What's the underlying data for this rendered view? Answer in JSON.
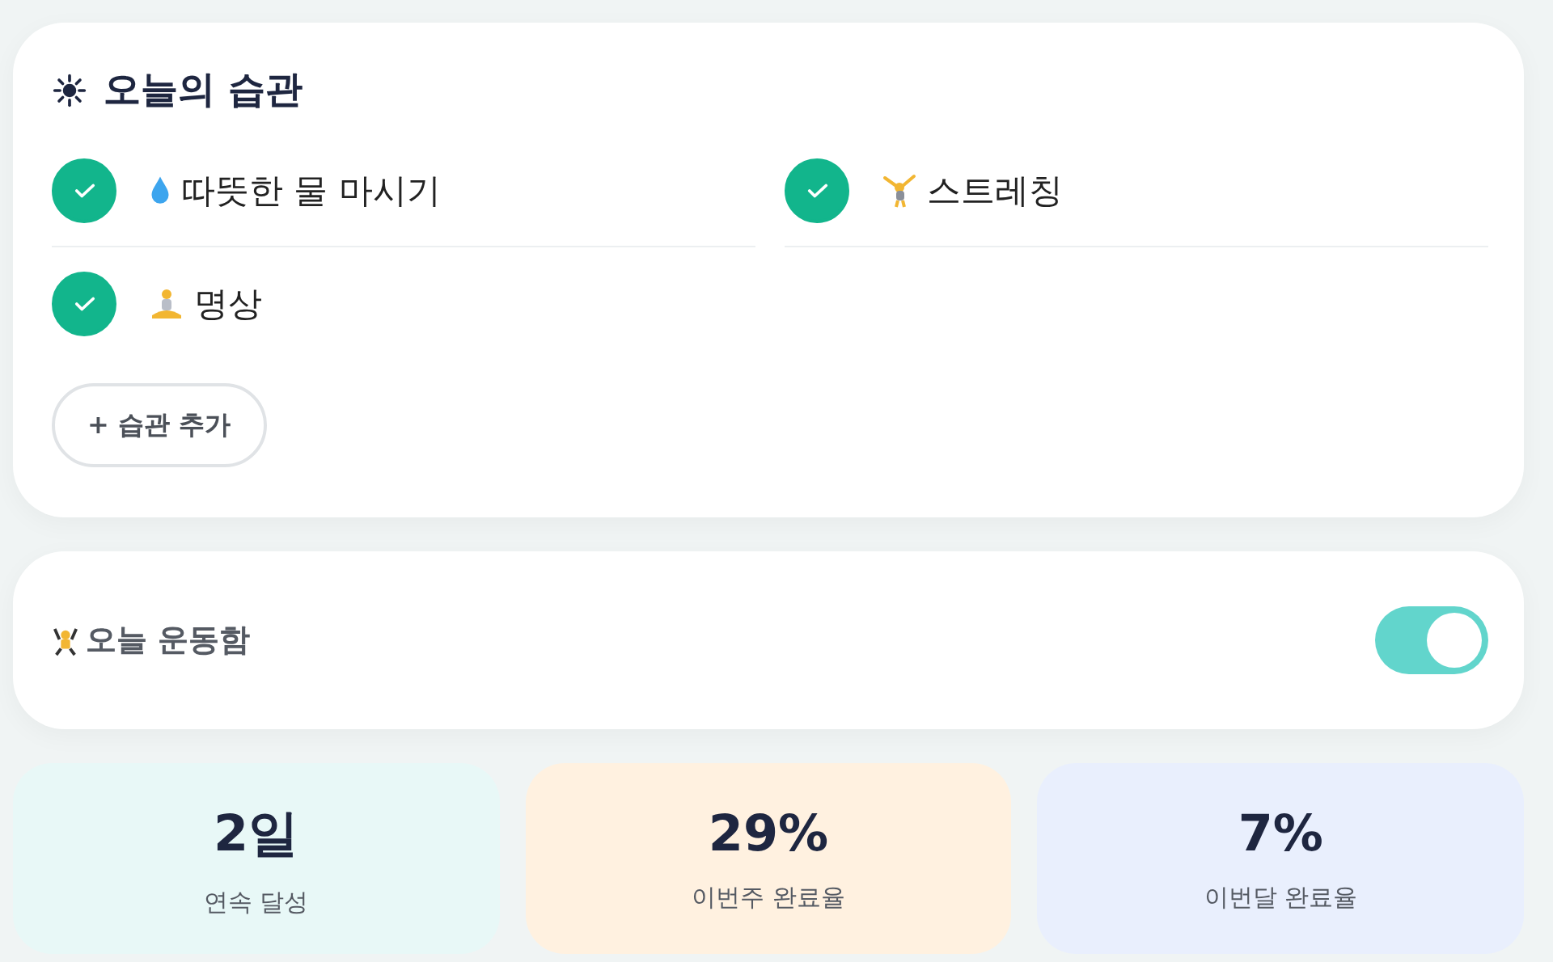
{
  "habits_card": {
    "title": "오늘의 습관",
    "habits": [
      {
        "label": "따뜻한 물 마시기",
        "kind": "drop",
        "checked": true
      },
      {
        "label": "스트레칭",
        "kind": "stretch",
        "checked": true
      },
      {
        "label": "명상",
        "kind": "meditate",
        "checked": true
      }
    ],
    "add_button": "+ 습관 추가"
  },
  "exercise_card": {
    "label": "오늘 운동함",
    "on": true
  },
  "stats": [
    {
      "value": "2일",
      "label": "연속 달성",
      "color": "#e8f8f7"
    },
    {
      "value": "29%",
      "label": "이번주 완료율",
      "color": "#fff1e0"
    },
    {
      "value": "7%",
      "label": "이번달 완료율",
      "color": "#e9effd"
    }
  ]
}
